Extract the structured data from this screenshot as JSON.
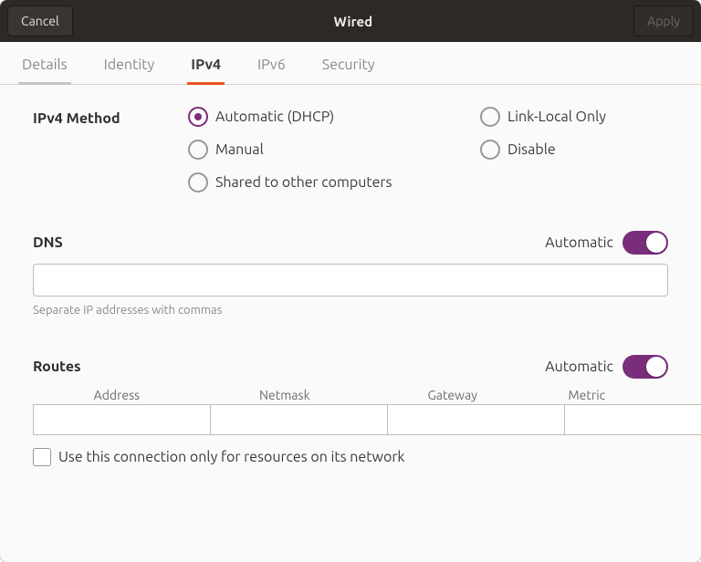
{
  "header": {
    "cancel": "Cancel",
    "title": "Wired",
    "apply": "Apply"
  },
  "tabs": {
    "details": "Details",
    "identity": "Identity",
    "ipv4": "IPv4",
    "ipv6": "IPv6",
    "security": "Security"
  },
  "method": {
    "label": "IPv4 Method",
    "auto": "Automatic (DHCP)",
    "linklocal": "Link-Local Only",
    "manual": "Manual",
    "disable": "Disable",
    "shared": "Shared to other computers",
    "selected": "auto"
  },
  "dns": {
    "label": "DNS",
    "automatic_label": "Automatic",
    "automatic_on": true,
    "value": "",
    "helper": "Separate IP addresses with commas"
  },
  "routes": {
    "label": "Routes",
    "automatic_label": "Automatic",
    "automatic_on": true,
    "cols": {
      "address": "Address",
      "netmask": "Netmask",
      "gateway": "Gateway",
      "metric": "Metric"
    },
    "row": {
      "address": "",
      "netmask": "",
      "gateway": "",
      "metric": ""
    },
    "only_resources": "Use this connection only for resources on its network",
    "only_resources_checked": false
  }
}
